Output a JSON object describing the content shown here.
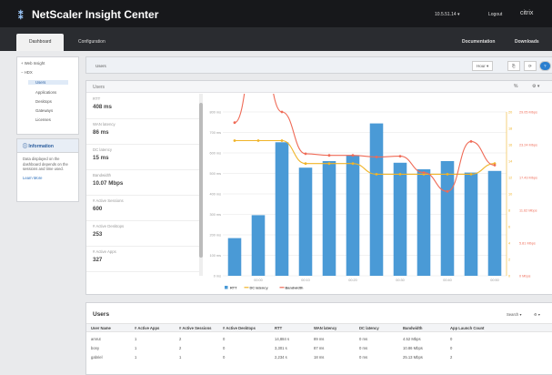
{
  "app": {
    "title": "NetScaler Insight Center",
    "time_label": "10.5.51.14",
    "logout": "Logout",
    "brand": "citrix"
  },
  "nav": {
    "tabs": [
      "Dashboard",
      "Configuration"
    ],
    "right": [
      "Documentation",
      "Downloads"
    ]
  },
  "tree": {
    "items": [
      "Web Insight",
      "HDX",
      "Users",
      "Applications",
      "Desktops",
      "Gateways",
      "Licenses"
    ]
  },
  "info": {
    "title": "Information",
    "text": "Data displayed on the dashboard depends on the sessions and time used.",
    "link": "Learn More"
  },
  "page": {
    "section": "Users",
    "sub": "Users",
    "range": "Hour"
  },
  "metrics": [
    {
      "label": "RTT",
      "value": "408 ms"
    },
    {
      "label": "WAN latency",
      "value": "86 ms"
    },
    {
      "label": "DC latency",
      "value": "15 ms"
    },
    {
      "label": "Bandwidth",
      "value": "10.07 Mbps"
    },
    {
      "label": "# Active Sessions",
      "value": "600"
    },
    {
      "label": "# Active Desktops",
      "value": "253"
    },
    {
      "label": "# Active Apps",
      "value": "327"
    }
  ],
  "chart_data": {
    "type": "bar",
    "categories": [
      "",
      "00:00",
      "",
      "00:10",
      "",
      "00:20",
      "",
      "00:30",
      "",
      "00:40",
      "",
      "00:50"
    ],
    "series": [
      {
        "name": "RTT",
        "type": "bar",
        "color": "#4a9ad6",
        "values": [
          230,
          370,
          815,
          660,
          700,
          735,
          930,
          690,
          650,
          700,
          630,
          640
        ]
      },
      {
        "name": "DC latency",
        "type": "line",
        "color": "#f0b429",
        "values": [
          16.5,
          16.5,
          16.5,
          13.7,
          13.7,
          13.7,
          12.4,
          12.4,
          12.4,
          12.4,
          12.4,
          13.7
        ]
      },
      {
        "name": "Bandwidth",
        "type": "line",
        "color": "#ef6b57",
        "values": [
          18.7,
          29.3,
          20,
          14.9,
          14.7,
          14.7,
          14.5,
          14.6,
          12.6,
          10.3,
          16.4,
          13.5
        ]
      }
    ],
    "y_left_ticks": [
      "0 ms",
      "100 ms",
      "200 ms",
      "300 ms",
      "400 ms",
      "500 ms",
      "600 ms",
      "700 ms",
      "800 ms"
    ],
    "y_right_ticks": [
      "0",
      "2",
      "4",
      "6",
      "8",
      "10",
      "12",
      "14",
      "16",
      "18",
      "20"
    ],
    "y_right2_ticks": [
      "0 Mbps",
      "5.81 Mbps",
      "11.62 Mbps",
      "17.43 Mbps",
      "23.24 Mbps",
      "29.05 Mbps"
    ],
    "ylim": [
      0,
      1000
    ],
    "legend": "bottom-left"
  },
  "table": {
    "title": "Users",
    "search": "Search",
    "columns": [
      "User Name",
      "# Active Apps",
      "# Active Sessions",
      "# Active Desktops",
      "RTT",
      "WAN latency",
      "DC latency",
      "Bandwidth",
      "App Launch Count"
    ],
    "rows": [
      [
        "amrut",
        "1",
        "2",
        "0",
        "14,884 s",
        "89 ms",
        "0 ms",
        "4.52 Mbps",
        "0"
      ],
      [
        "bony",
        "1",
        "2",
        "0",
        "3,301 s",
        "87 ms",
        "0 ms",
        "10.86 Mbps",
        "0"
      ],
      [
        "gabriel",
        "1",
        "1",
        "0",
        "2,234 s",
        "18 ms",
        "0 ms",
        "25.13 Mbps",
        "2"
      ]
    ]
  }
}
